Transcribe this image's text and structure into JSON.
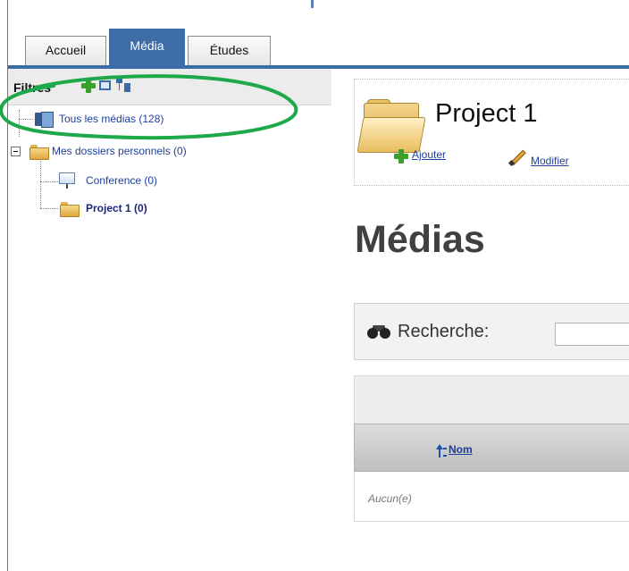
{
  "tabs": [
    {
      "label": "Accueil",
      "active": false
    },
    {
      "label": "Média",
      "active": true
    },
    {
      "label": "Études",
      "active": false
    }
  ],
  "filters": {
    "label": "Filtres",
    "icons": [
      "add-filter-icon",
      "collapse-icon",
      "expand-tree-icon"
    ]
  },
  "tree": {
    "all_media": {
      "label": "Tous les médias (128)",
      "icon": "media-library-icon"
    },
    "personal_folders": {
      "label": "Mes dossiers personnels (0)",
      "icon": "folders-icon",
      "expanded": true
    },
    "children": [
      {
        "label": "Conference (0)",
        "icon": "presentation-screen-icon",
        "selected": false
      },
      {
        "label": "Project 1 (0)",
        "icon": "folder-open-icon",
        "selected": true
      }
    ]
  },
  "project": {
    "title": "Project 1",
    "add_label": "Ajouter",
    "edit_label": "Modifier"
  },
  "media_section": {
    "heading": "Médias",
    "search_label": "Recherche:",
    "search_value": ""
  },
  "table": {
    "columns": [
      "Nom"
    ],
    "empty_text": "Aucun(e)"
  },
  "annotation": {
    "color": "#1ea84a",
    "target": "Tous les médias (128)"
  },
  "colors": {
    "accent": "#3e6da8",
    "link": "#1e3f9c"
  }
}
